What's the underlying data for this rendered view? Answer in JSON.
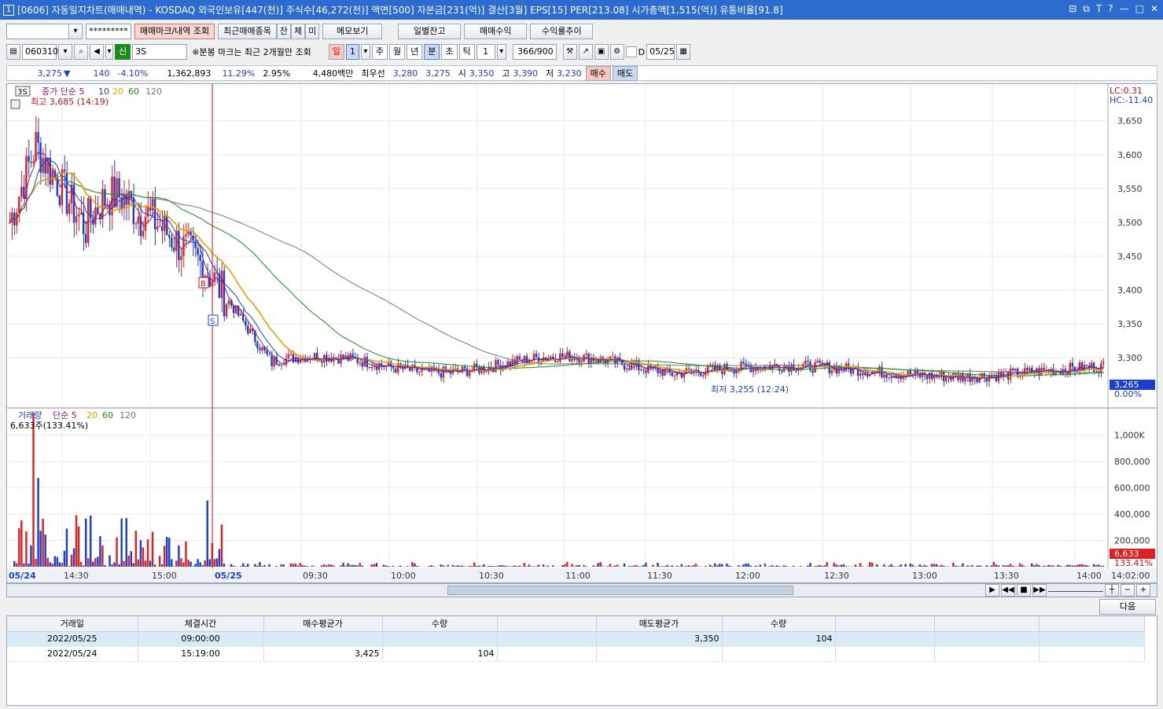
{
  "window": {
    "num": "1",
    "title": "[0606] 자동일지차트(매매내역) - KOSDAQ 외국인보유[447(천)] 주식수[46,272(천)] 액면[500] 자본금[231(억)] 결산[3월] EPS[15] PER[213.08] 시가총액[1,515(억)] 유통비율[91.8]",
    "controls": [
      "⊟",
      "⧉",
      "T",
      "?",
      "—",
      "□",
      "✕"
    ]
  },
  "toolbar1": {
    "account_masked": "*********",
    "buttons": [
      "매매마크/내역 조회",
      "최근매매종목",
      "잔",
      "체",
      "미",
      "메모보기",
      "일별잔고",
      "매매수익",
      "수익률추이"
    ]
  },
  "toolbar2": {
    "code": "060310",
    "badge": "신",
    "stock_name": "3S",
    "notice": "※분봉 마크는 최근 2개월만 조회",
    "period_tabs": [
      "일",
      "1",
      "주",
      "월",
      "년",
      "분",
      "초",
      "틱"
    ],
    "interval": "1",
    "count": "366/900",
    "date_label": "D",
    "date": "05/25"
  },
  "quote": {
    "price": "3,275",
    "change": "140",
    "change_pct": "-4.10%",
    "volume": "1,362,893",
    "vol_ratio": "11.29%",
    "turnover": "2.95%",
    "amount": "4,480백만",
    "best_label": "최우선",
    "ask": "3,280",
    "bid": "3,275",
    "open_label": "시",
    "open": "3,350",
    "high_label": "고",
    "high": "3,390",
    "low_label": "저",
    "low": "3,230",
    "buy_button": "매수",
    "sell_button": "매도"
  },
  "price_panel": {
    "code_tag": "3S",
    "legend": [
      "종가 단순 5",
      "10",
      "20",
      "60",
      "120"
    ],
    "legend_colors": [
      "#8a1f7a",
      "#1a3fd0",
      "#e8a000",
      "#1d8a1d",
      "#777777"
    ],
    "high_marker": "최고 3,685 (14:19)",
    "low_marker": "최저 3,255 (12:24)",
    "lc": "LC:0.31",
    "hc": "HC:-11.40",
    "y_ticks": [
      "3,650",
      "3,600",
      "3,550",
      "3,500",
      "3,450",
      "3,400",
      "3,350",
      "3,300"
    ],
    "current_price": "3,265",
    "current_pct": "0.00%",
    "trade_marks": [
      "B",
      "S"
    ]
  },
  "volume_panel": {
    "legend": [
      "거래량",
      "단순 5",
      "20",
      "60",
      "120"
    ],
    "legend_colors": [
      "#1a3fd0",
      "#8a1f7a",
      "#e8a000",
      "#1d8a1d",
      "#777777"
    ],
    "last_volume": "6,633주(133.41%)",
    "y_ticks": [
      "1,000K",
      "800,000",
      "600,000",
      "400,000",
      "200,000"
    ],
    "current_volume": "6,633",
    "current_pct": "133.41%"
  },
  "x_axis": [
    "05/24",
    "14:30",
    "15:00",
    "05/25",
    "09:30",
    "10:00",
    "10:30",
    "11:00",
    "11:30",
    "12:00",
    "12:30",
    "13:00",
    "13:30",
    "14:00",
    "14:02:00"
  ],
  "next_button": "다음",
  "trade_table": {
    "headers": [
      "거래일",
      "체결시간",
      "매수평균가",
      "수량",
      "",
      "매도평균가",
      "수량",
      "",
      "",
      ""
    ],
    "rows": [
      [
        "2022/05/25",
        "09:00:00",
        "",
        "",
        "",
        "3,350",
        "104",
        "",
        "",
        ""
      ],
      [
        "2022/05/24",
        "15:19:00",
        "3,425",
        "104",
        "",
        "",
        "",
        "",
        "",
        ""
      ]
    ]
  },
  "chart_data": {
    "type": "candlestick",
    "price_axis_range": [
      3235,
      3695
    ],
    "volume_axis_max": 1100000,
    "series_names": [
      "종가",
      "5",
      "10",
      "20",
      "60",
      "120",
      "거래량"
    ]
  }
}
